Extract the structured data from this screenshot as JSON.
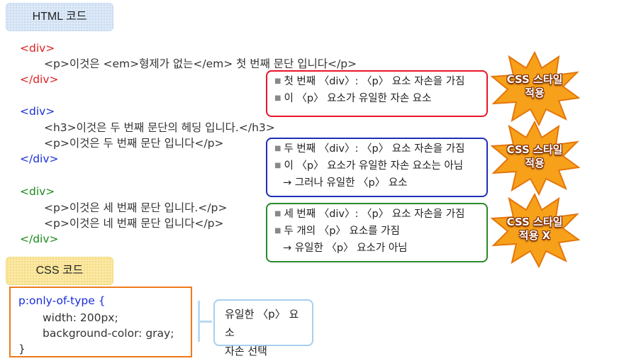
{
  "html_tag": "HTML 코드",
  "css_tag": "CSS 코드",
  "html_code": {
    "g1_open": "<div>",
    "g1_p": "<p>이것은 <em>형제가 없는</em> 첫 번째 문단 입니다</p>",
    "g1_close": "</div>",
    "g2_open": "<div>",
    "g2_h3": "<h3>이것은 두 번째 문단의 헤딩 입니다.</h3>",
    "g2_p": "<p>이것은 두 번째 문단 입니다</p>",
    "g2_close": "</div>",
    "g3_open": "<div>",
    "g3_p1": "<p>이것은 세 번째 문단 입니다.</p>",
    "g3_p2": "<p>이것은 네 번째 문단 입니다</p>",
    "g3_close": "</div>"
  },
  "notes": {
    "red": [
      "첫 번째 〈div〉: 〈p〉 요소 자손을 가짐",
      "이 〈p〉 요소가 유일한 자손 요소"
    ],
    "blue": [
      "두 번째 〈div〉: 〈p〉 요소 자손을 가짐",
      "이 〈p〉 요소가 유일한 자손 요소는 아님",
      "→ 그러나 유일한 〈p〉 요소"
    ],
    "green": [
      "세 번째 〈div〉: 〈p〉 요소 자손을 가짐",
      "두 개의 〈p〉 요소를 가짐",
      "→ 유일한 〈p〉 요소가 아님"
    ]
  },
  "bursts": [
    {
      "line1": "CSS 스타일",
      "line2": "적용"
    },
    {
      "line1": "CSS 스타일",
      "line2": "적용"
    },
    {
      "line1": "CSS 스타일",
      "line2": "적용 X"
    }
  ],
  "css_code": {
    "selector": "p:only-of-type {",
    "decl1": "width: 200px;",
    "decl2": "background-color: gray;",
    "close": "}"
  },
  "css_note": [
    "유일한 〈p〉 요소",
    "자손 선택"
  ],
  "colors": {
    "red": "#e8162a",
    "blue": "#1f2fb8",
    "green": "#2a8a2a",
    "orange": "#f07a1a",
    "burst": "#f7a11a"
  }
}
